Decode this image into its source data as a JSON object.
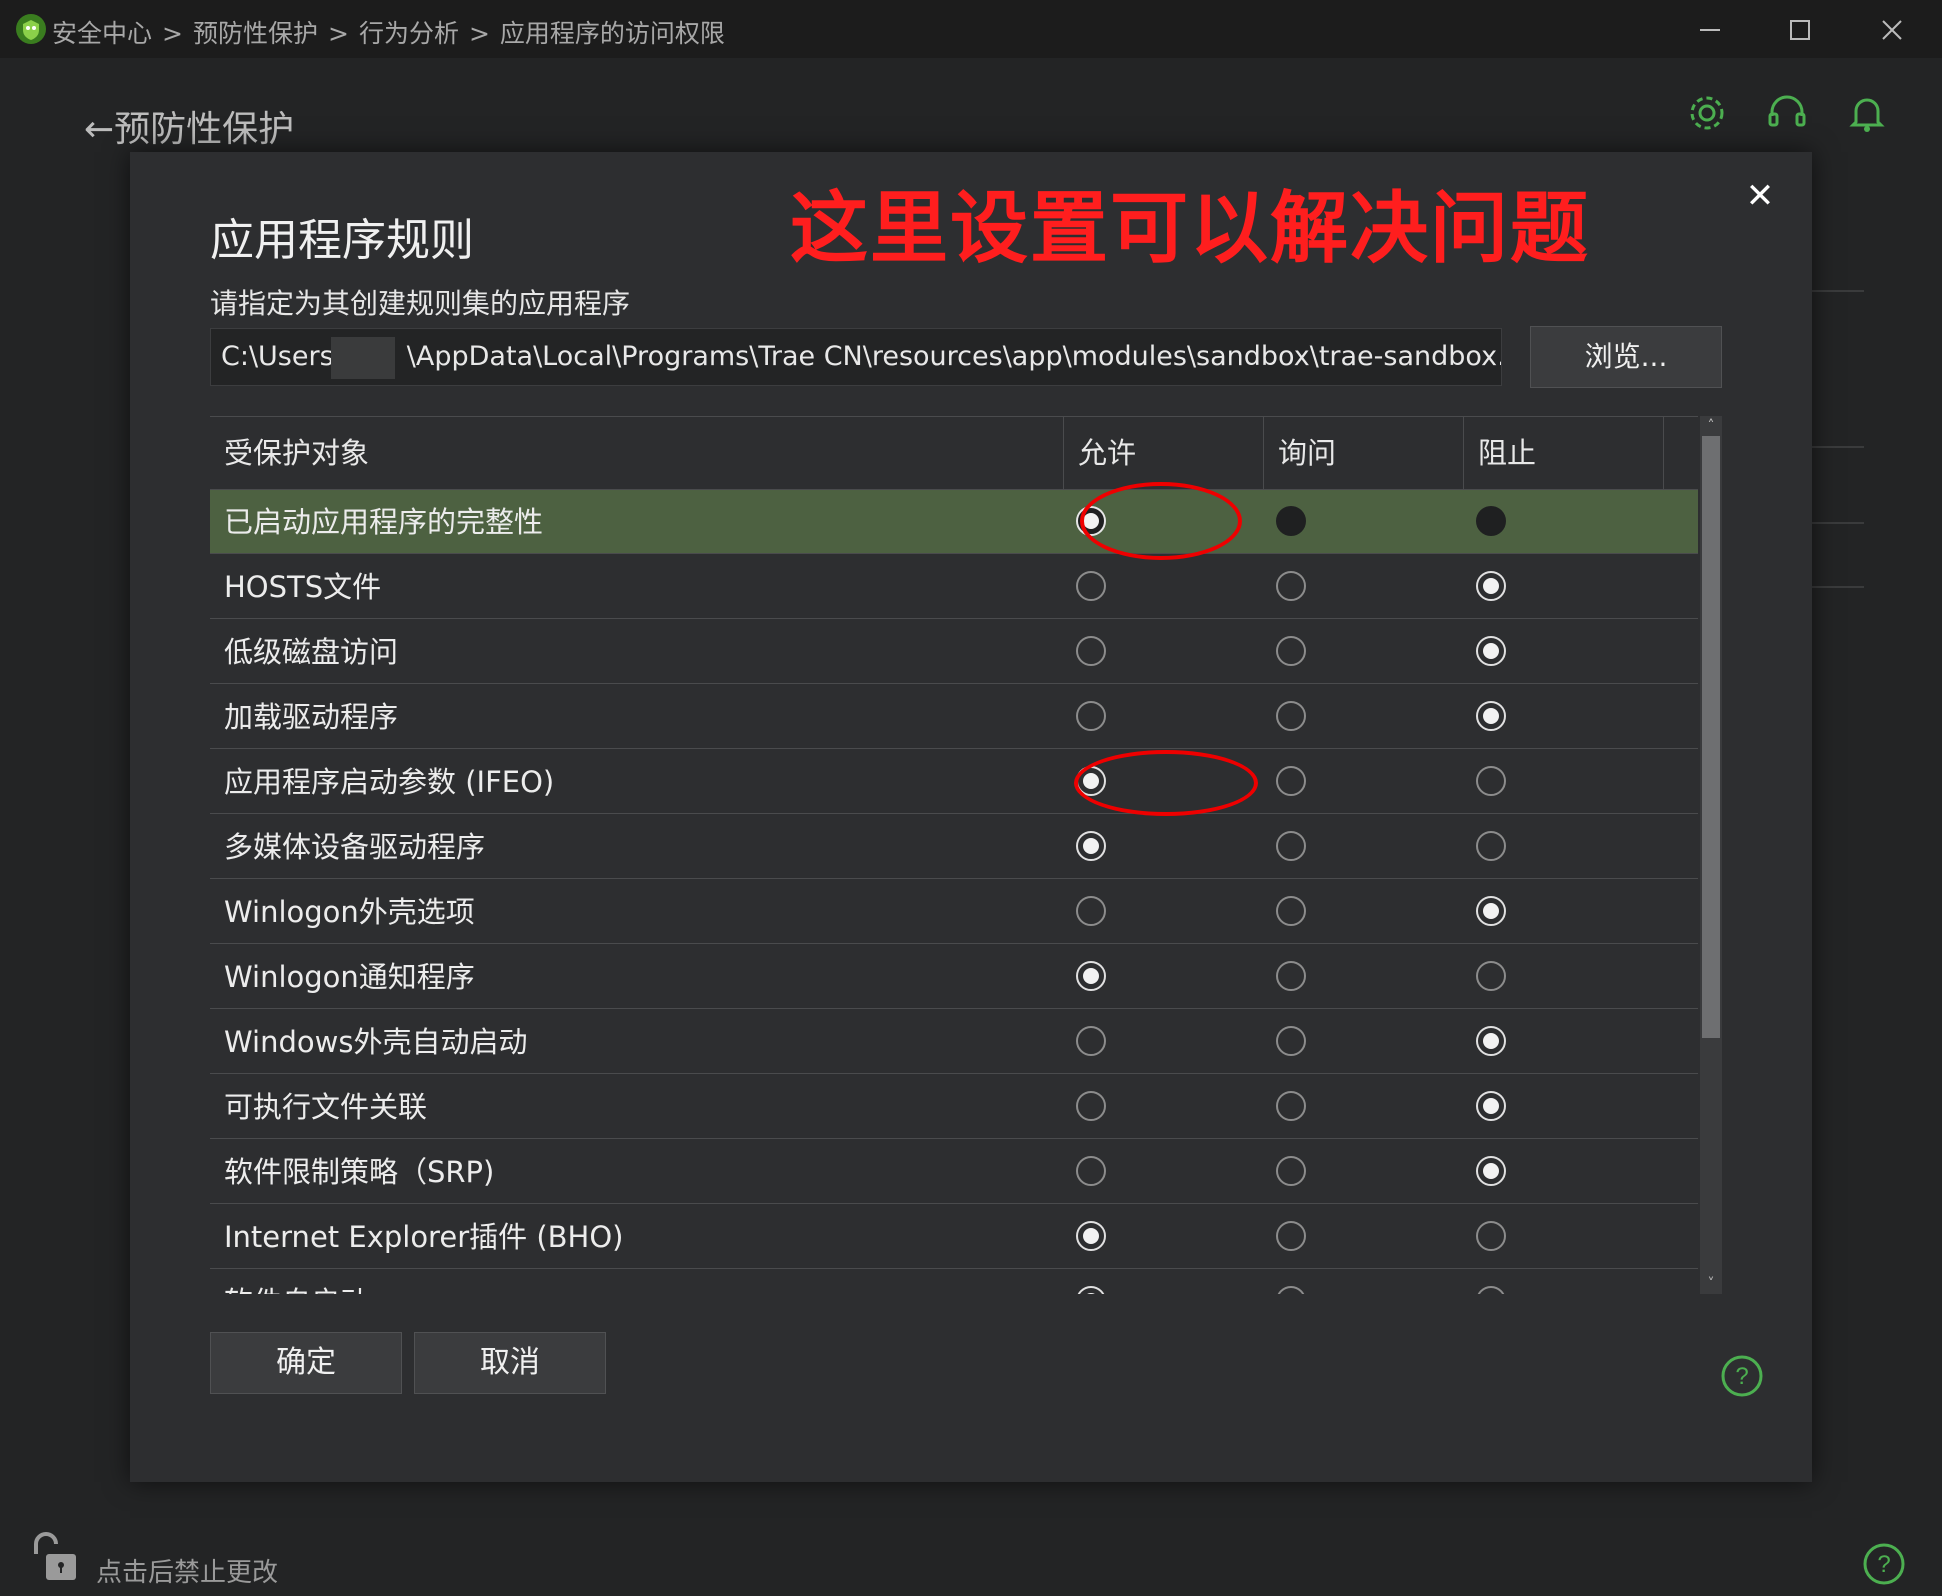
{
  "titlebar": {
    "breadcrumbs": [
      "安全中心",
      ">",
      "预防性保护",
      ">",
      "行为分析",
      ">",
      "应用程序的访问权限"
    ]
  },
  "page": {
    "back_title": "预防性保护",
    "lock_text": "点击后禁止更改"
  },
  "dialog": {
    "title": "应用程序规则",
    "annotation": "这里设置可以解决问题",
    "field_label": "请指定为其创建规则集的应用程序",
    "path_prefix": "C:\\Users\\",
    "path_suffix": "\\AppData\\Local\\Programs\\Trae CN\\resources\\app\\modules\\sandbox\\trae-sandbox.exe",
    "browse_label": "浏览...",
    "columns": [
      "受保护对象",
      "允许",
      "询问",
      "阻止"
    ],
    "rows": [
      {
        "label": "已启动应用程序的完整性",
        "choice": "允许"
      },
      {
        "label": "HOSTS文件",
        "choice": "阻止"
      },
      {
        "label": "低级磁盘访问",
        "choice": "阻止"
      },
      {
        "label": "加载驱动程序",
        "choice": "阻止"
      },
      {
        "label": "应用程序启动参数 (IFEO)",
        "choice": "允许"
      },
      {
        "label": "多媒体设备驱动程序",
        "choice": "允许"
      },
      {
        "label": "Winlogon外壳选项",
        "choice": "阻止"
      },
      {
        "label": "Winlogon通知程序",
        "choice": "允许"
      },
      {
        "label": "Windows外壳自动启动",
        "choice": "阻止"
      },
      {
        "label": "可执行文件关联",
        "choice": "阻止"
      },
      {
        "label": "软件限制策略（SRP)",
        "choice": "阻止"
      },
      {
        "label": "Internet Explorer插件 (BHO)",
        "choice": "允许"
      },
      {
        "label": "软件自启动",
        "choice": "允许"
      }
    ],
    "ok_label": "确定",
    "cancel_label": "取消"
  },
  "colors": {
    "accent_green": "#4caf50",
    "selected_row": "#4d6141",
    "annotation_red": "#ff1e1e"
  }
}
